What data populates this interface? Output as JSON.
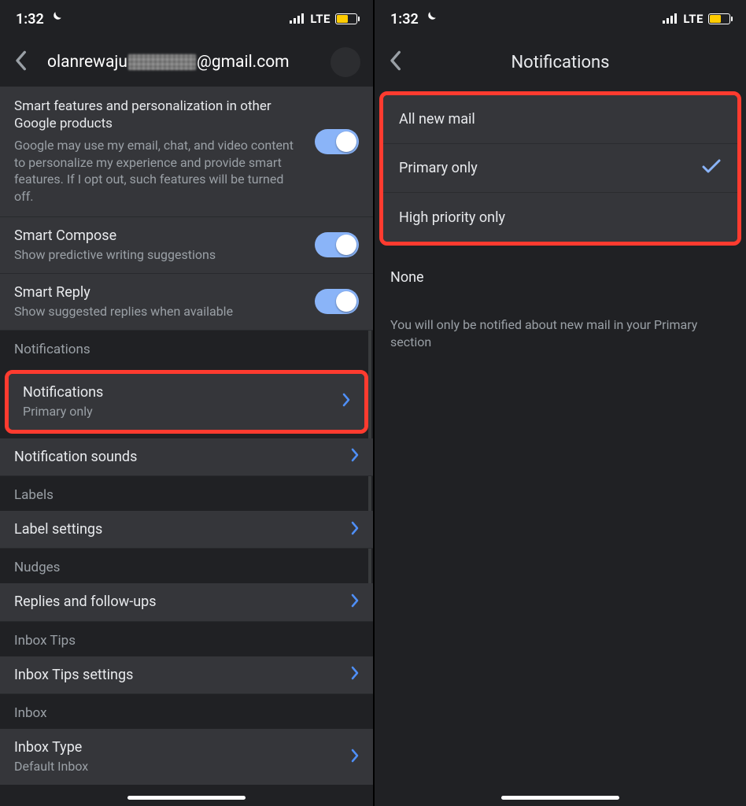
{
  "status": {
    "time": "1:32",
    "net": "LTE"
  },
  "left": {
    "header": {
      "emailPrefix": "olanrewaju",
      "emailSuffix": "@gmail.com"
    },
    "smartFeatures": {
      "title": "Smart features and personalization in other Google products",
      "desc": "Google may use my email, chat, and video content to personalize my experience and provide smart features. If I opt out, such features will be turned off."
    },
    "smartCompose": {
      "title": "Smart Compose",
      "sub": "Show predictive writing suggestions"
    },
    "smartReply": {
      "title": "Smart Reply",
      "sub": "Show suggested replies when available"
    },
    "sections": {
      "notifications": "Notifications",
      "labels": "Labels",
      "nudges": "Nudges",
      "inboxTips": "Inbox Tips",
      "inbox": "Inbox"
    },
    "rows": {
      "notifications": {
        "title": "Notifications",
        "sub": "Primary only"
      },
      "notificationSounds": {
        "title": "Notification sounds"
      },
      "labelSettings": {
        "title": "Label settings"
      },
      "repliesFollowups": {
        "title": "Replies and follow-ups"
      },
      "inboxTipsSettings": {
        "title": "Inbox Tips settings"
      },
      "inboxType": {
        "title": "Inbox Type",
        "sub": "Default Inbox"
      }
    }
  },
  "right": {
    "title": "Notifications",
    "options": {
      "all": "All new mail",
      "primary": "Primary only",
      "high": "High priority only",
      "none": "None"
    },
    "footer": "You will only be notified about new mail in your Primary section"
  }
}
